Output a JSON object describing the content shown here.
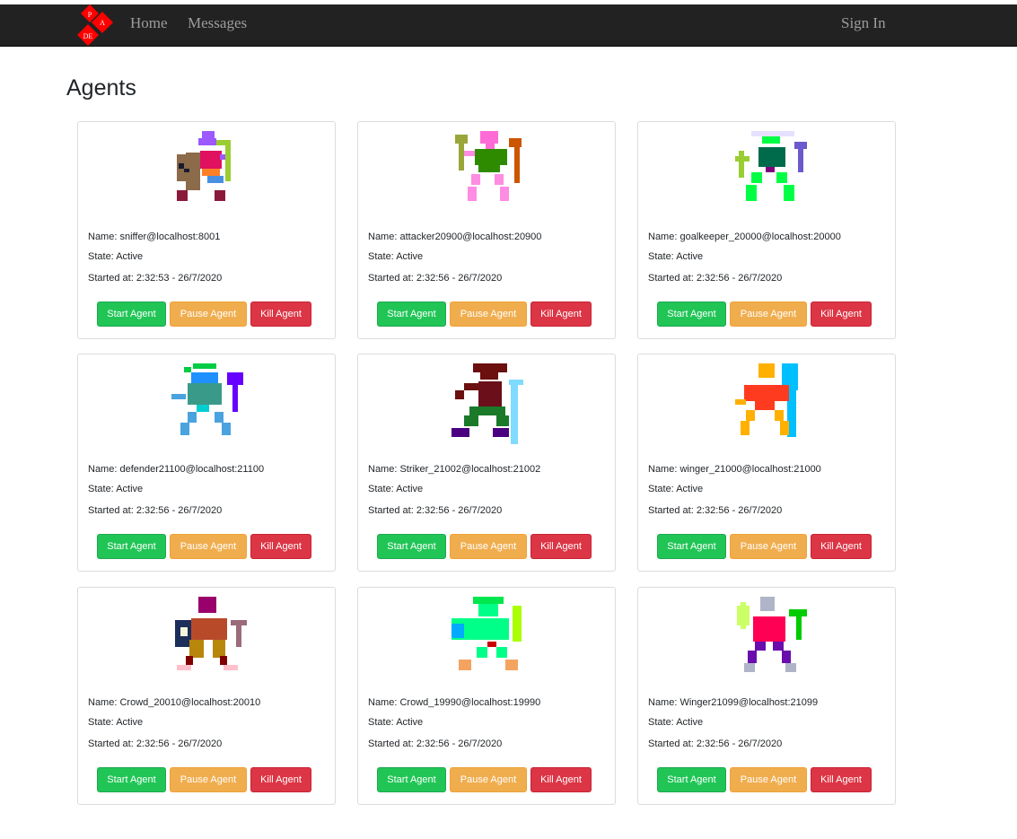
{
  "navbar": {
    "logo_letters": [
      "P",
      "A",
      "DE"
    ],
    "links": [
      "Home",
      "Messages"
    ],
    "sign_in": "Sign In",
    "colors": {
      "background": "#222222",
      "link": "#9d9d9d",
      "logo": "#ff0000"
    }
  },
  "page_title": "Agents",
  "labels": {
    "name": "Name: ",
    "state": "State: ",
    "started": "Started at: "
  },
  "buttons": {
    "start": "Start Agent",
    "pause": "Pause Agent",
    "kill": "Kill Agent"
  },
  "button_colors": {
    "start": "#20c556",
    "pause": "#f0ad4e",
    "kill": "#dc3545"
  },
  "agents": [
    {
      "name": "sniffer@localhost:8001",
      "state": "Active",
      "started": "2:32:53 - 26/7/2020",
      "avatar": "pixel-character-avatar"
    },
    {
      "name": "attacker20900@localhost:20900",
      "state": "Active",
      "started": "2:32:56 - 26/7/2020",
      "avatar": "pixel-character-avatar"
    },
    {
      "name": "goalkeeper_20000@localhost:20000",
      "state": "Active",
      "started": "2:32:56 - 26/7/2020",
      "avatar": "pixel-character-avatar"
    },
    {
      "name": "defender21100@localhost:21100",
      "state": "Active",
      "started": "2:32:56 - 26/7/2020",
      "avatar": "pixel-character-avatar"
    },
    {
      "name": "Striker_21002@localhost:21002",
      "state": "Active",
      "started": "2:32:56 - 26/7/2020",
      "avatar": "pixel-character-avatar"
    },
    {
      "name": "winger_21000@localhost:21000",
      "state": "Active",
      "started": "2:32:56 - 26/7/2020",
      "avatar": "pixel-character-avatar"
    },
    {
      "name": "Crowd_20010@localhost:20010",
      "state": "Active",
      "started": "2:32:56 - 26/7/2020",
      "avatar": "pixel-character-avatar"
    },
    {
      "name": "Crowd_19990@localhost:19990",
      "state": "Active",
      "started": "2:32:56 - 26/7/2020",
      "avatar": "pixel-character-avatar"
    },
    {
      "name": "Winger21099@localhost:21099",
      "state": "Active",
      "started": "2:32:56 - 26/7/2020",
      "avatar": "pixel-character-avatar"
    }
  ]
}
